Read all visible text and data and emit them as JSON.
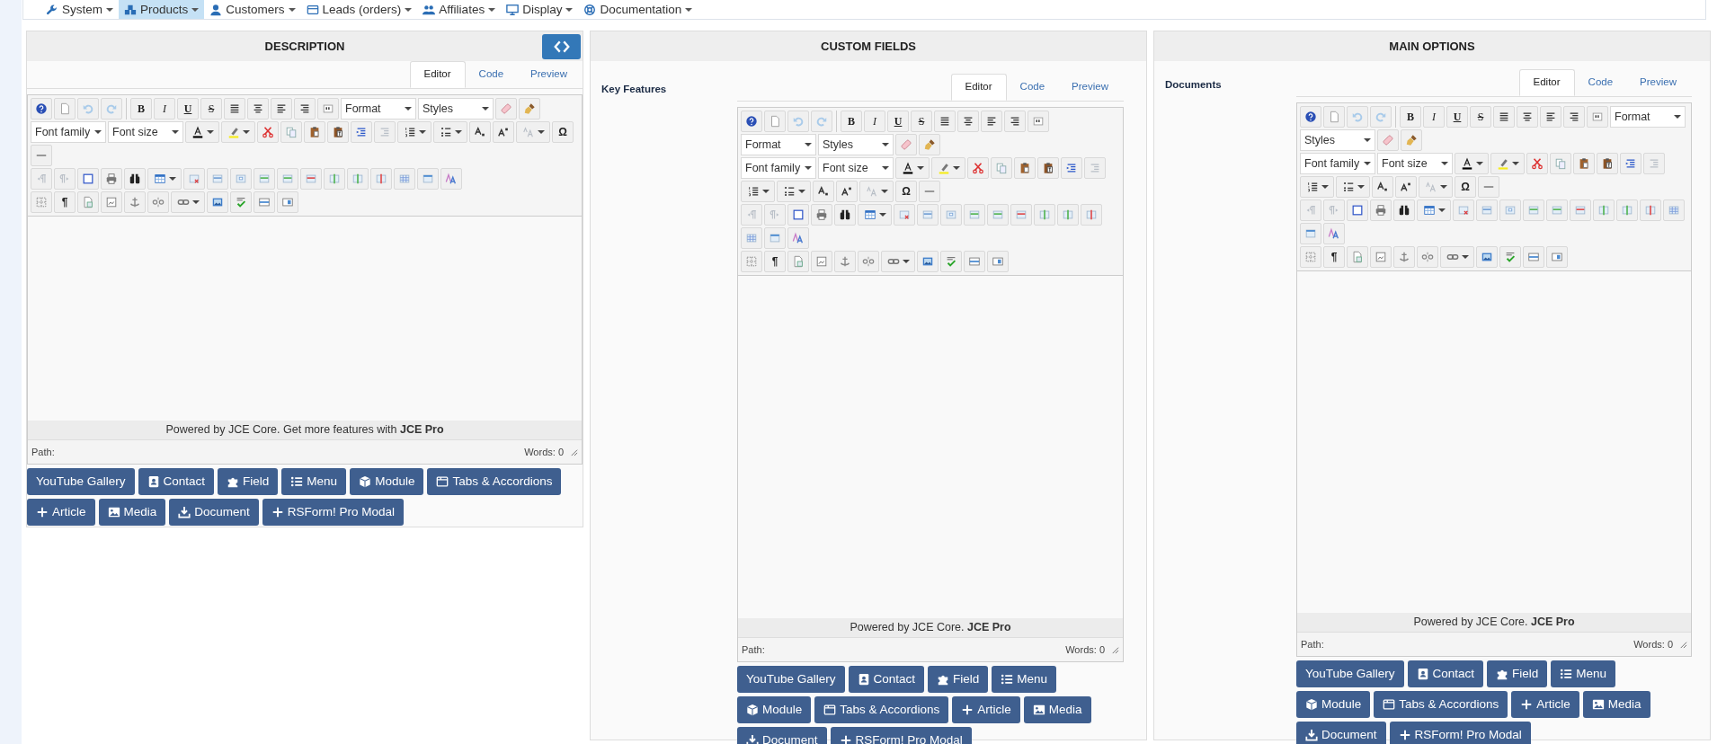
{
  "nav": {
    "items": [
      {
        "label": "System",
        "selected": false
      },
      {
        "label": "Products",
        "selected": true
      },
      {
        "label": "Customers",
        "selected": false
      },
      {
        "label": "Leads (orders)",
        "selected": false
      },
      {
        "label": "Affiliates",
        "selected": false
      },
      {
        "label": "Display",
        "selected": false
      },
      {
        "label": "Documentation",
        "selected": false
      }
    ]
  },
  "panels": [
    {
      "title": "DESCRIPTION",
      "code_button": true,
      "editor": {
        "tabs": [
          {
            "label": "Editor",
            "selected": true
          },
          {
            "label": "Code",
            "selected": false
          },
          {
            "label": "Preview",
            "selected": false
          }
        ],
        "toolbar": [
          [
            {
              "kind": "button"
            },
            {
              "kind": "button"
            },
            {
              "kind": "button"
            },
            {
              "kind": "button"
            },
            {
              "kind": "separator"
            },
            {
              "kind": "glyph",
              "text": "B"
            },
            {
              "kind": "glyph",
              "text": "I"
            },
            {
              "kind": "glyph",
              "text": "U"
            },
            {
              "kind": "glyph",
              "text": "S"
            },
            {
              "kind": "button"
            },
            {
              "kind": "button"
            },
            {
              "kind": "button"
            },
            {
              "kind": "button"
            },
            {
              "kind": "button"
            },
            {
              "kind": "select",
              "label": "Format"
            },
            {
              "kind": "select",
              "label": "Styles"
            },
            {
              "kind": "button"
            },
            {
              "kind": "button"
            }
          ],
          [
            {
              "kind": "select",
              "label": "Font family"
            },
            {
              "kind": "select",
              "label": "Font size"
            },
            {
              "kind": "split"
            },
            {
              "kind": "split"
            },
            {
              "kind": "button"
            },
            {
              "kind": "button"
            },
            {
              "kind": "button"
            },
            {
              "kind": "button"
            },
            {
              "kind": "button"
            },
            {
              "kind": "button"
            },
            {
              "kind": "split"
            },
            {
              "kind": "split"
            },
            {
              "kind": "button"
            },
            {
              "kind": "button"
            },
            {
              "kind": "split"
            },
            {
              "kind": "glyph",
              "text": "Ω"
            },
            {
              "kind": "button"
            }
          ],
          [
            {
              "kind": "button"
            },
            {
              "kind": "button"
            },
            {
              "kind": "button"
            },
            {
              "kind": "button"
            },
            {
              "kind": "button"
            },
            {
              "kind": "split"
            },
            {
              "kind": "button"
            },
            {
              "kind": "button"
            },
            {
              "kind": "button"
            },
            {
              "kind": "button"
            },
            {
              "kind": "button"
            },
            {
              "kind": "button"
            },
            {
              "kind": "button"
            },
            {
              "kind": "button"
            },
            {
              "kind": "button"
            },
            {
              "kind": "button"
            },
            {
              "kind": "button"
            },
            {
              "kind": "button"
            }
          ],
          [
            {
              "kind": "button"
            },
            {
              "kind": "glyph",
              "text": "¶"
            },
            {
              "kind": "button"
            },
            {
              "kind": "button"
            },
            {
              "kind": "button"
            },
            {
              "kind": "button"
            },
            {
              "kind": "split"
            },
            {
              "kind": "button"
            },
            {
              "kind": "button"
            },
            {
              "kind": "button"
            },
            {
              "kind": "button"
            }
          ]
        ],
        "notice": "Powered by JCE Core. Get more features with **JCE Pro**",
        "path_label": "Path:",
        "word_count": "Words: 0"
      },
      "buttons": [
        {
          "label": "YouTube Gallery"
        },
        {
          "label": "Contact"
        },
        {
          "label": "Field"
        },
        {
          "label": "Menu"
        },
        {
          "label": "Module"
        },
        {
          "label": "Tabs & Accordions"
        },
        {
          "label": "Article"
        },
        {
          "label": "Media"
        },
        {
          "label": "Document"
        },
        {
          "label": "RSForm! Pro Modal"
        }
      ]
    },
    {
      "title": "CUSTOM FIELDS",
      "field_label": "Key Features",
      "editor": {
        "tabs": [
          {
            "label": "Editor",
            "selected": true
          },
          {
            "label": "Code",
            "selected": false
          },
          {
            "label": "Preview",
            "selected": false
          }
        ],
        "toolbar": [
          [
            {
              "kind": "button"
            },
            {
              "kind": "button"
            },
            {
              "kind": "button"
            },
            {
              "kind": "button"
            },
            {
              "kind": "separator"
            },
            {
              "kind": "glyph",
              "text": "B"
            },
            {
              "kind": "glyph",
              "text": "I"
            },
            {
              "kind": "glyph",
              "text": "U"
            },
            {
              "kind": "glyph",
              "text": "S"
            },
            {
              "kind": "button"
            },
            {
              "kind": "button"
            },
            {
              "kind": "button"
            },
            {
              "kind": "button"
            },
            {
              "kind": "button"
            },
            {
              "kind": "select",
              "label": "Format"
            },
            {
              "kind": "select",
              "label": "Styles"
            },
            {
              "kind": "button"
            },
            {
              "kind": "button"
            }
          ],
          [
            {
              "kind": "select",
              "label": "Font family"
            },
            {
              "kind": "select",
              "label": "Font size"
            },
            {
              "kind": "split"
            },
            {
              "kind": "split"
            },
            {
              "kind": "button"
            },
            {
              "kind": "button"
            },
            {
              "kind": "button"
            },
            {
              "kind": "button"
            },
            {
              "kind": "button"
            },
            {
              "kind": "button"
            },
            {
              "kind": "split"
            },
            {
              "kind": "split"
            },
            {
              "kind": "button"
            },
            {
              "kind": "button"
            },
            {
              "kind": "split"
            },
            {
              "kind": "glyph",
              "text": "Ω"
            },
            {
              "kind": "button"
            }
          ],
          [
            {
              "kind": "button"
            },
            {
              "kind": "button"
            },
            {
              "kind": "button"
            },
            {
              "kind": "button"
            },
            {
              "kind": "button"
            },
            {
              "kind": "split"
            },
            {
              "kind": "button"
            },
            {
              "kind": "button"
            },
            {
              "kind": "button"
            },
            {
              "kind": "button"
            },
            {
              "kind": "button"
            },
            {
              "kind": "button"
            },
            {
              "kind": "button"
            },
            {
              "kind": "button"
            },
            {
              "kind": "button"
            },
            {
              "kind": "button"
            },
            {
              "kind": "button"
            },
            {
              "kind": "button"
            }
          ],
          [
            {
              "kind": "button"
            },
            {
              "kind": "glyph",
              "text": "¶"
            },
            {
              "kind": "button"
            },
            {
              "kind": "button"
            },
            {
              "kind": "button"
            },
            {
              "kind": "button"
            },
            {
              "kind": "split"
            },
            {
              "kind": "button"
            },
            {
              "kind": "button"
            },
            {
              "kind": "button"
            },
            {
              "kind": "button"
            }
          ]
        ],
        "notice": "Powered by JCE Core. **JCE Pro**",
        "path_label": "Path:",
        "word_count": "Words: 0"
      },
      "buttons": [
        {
          "label": "YouTube Gallery"
        },
        {
          "label": "Contact"
        },
        {
          "label": "Field"
        },
        {
          "label": "Menu"
        },
        {
          "label": "Module"
        },
        {
          "label": "Tabs & Accordions"
        },
        {
          "label": "Article"
        },
        {
          "label": "Media"
        },
        {
          "label": "Document"
        },
        {
          "label": "RSForm! Pro Modal"
        }
      ]
    },
    {
      "title": "MAIN OPTIONS",
      "field_label": "Documents",
      "editor": {
        "tabs": [
          {
            "label": "Editor",
            "selected": true
          },
          {
            "label": "Code",
            "selected": false
          },
          {
            "label": "Preview",
            "selected": false
          }
        ],
        "toolbar": [
          [
            {
              "kind": "button"
            },
            {
              "kind": "button"
            },
            {
              "kind": "button"
            },
            {
              "kind": "button"
            },
            {
              "kind": "separator"
            },
            {
              "kind": "glyph",
              "text": "B"
            },
            {
              "kind": "glyph",
              "text": "I"
            },
            {
              "kind": "glyph",
              "text": "U"
            },
            {
              "kind": "glyph",
              "text": "S"
            },
            {
              "kind": "button"
            },
            {
              "kind": "button"
            },
            {
              "kind": "button"
            },
            {
              "kind": "button"
            },
            {
              "kind": "button"
            },
            {
              "kind": "select",
              "label": "Format"
            },
            {
              "kind": "select",
              "label": "Styles"
            },
            {
              "kind": "button"
            },
            {
              "kind": "button"
            }
          ],
          [
            {
              "kind": "select",
              "label": "Font family"
            },
            {
              "kind": "select",
              "label": "Font size"
            },
            {
              "kind": "split"
            },
            {
              "kind": "split"
            },
            {
              "kind": "button"
            },
            {
              "kind": "button"
            },
            {
              "kind": "button"
            },
            {
              "kind": "button"
            },
            {
              "kind": "button"
            },
            {
              "kind": "button"
            },
            {
              "kind": "split"
            },
            {
              "kind": "split"
            },
            {
              "kind": "button"
            },
            {
              "kind": "button"
            },
            {
              "kind": "split"
            },
            {
              "kind": "glyph",
              "text": "Ω"
            },
            {
              "kind": "button"
            }
          ],
          [
            {
              "kind": "button"
            },
            {
              "kind": "button"
            },
            {
              "kind": "button"
            },
            {
              "kind": "button"
            },
            {
              "kind": "button"
            },
            {
              "kind": "split"
            },
            {
              "kind": "button"
            },
            {
              "kind": "button"
            },
            {
              "kind": "button"
            },
            {
              "kind": "button"
            },
            {
              "kind": "button"
            },
            {
              "kind": "button"
            },
            {
              "kind": "button"
            },
            {
              "kind": "button"
            },
            {
              "kind": "button"
            },
            {
              "kind": "button"
            },
            {
              "kind": "button"
            },
            {
              "kind": "button"
            }
          ],
          [
            {
              "kind": "button"
            },
            {
              "kind": "glyph",
              "text": "¶"
            },
            {
              "kind": "button"
            },
            {
              "kind": "button"
            },
            {
              "kind": "button"
            },
            {
              "kind": "button"
            },
            {
              "kind": "split"
            },
            {
              "kind": "button"
            },
            {
              "kind": "button"
            },
            {
              "kind": "button"
            },
            {
              "kind": "button"
            }
          ]
        ],
        "notice": "Powered by JCE Core. **JCE Pro**",
        "path_label": "Path:",
        "word_count": "Words: 0"
      },
      "buttons": [
        {
          "label": "YouTube Gallery"
        },
        {
          "label": "Contact"
        },
        {
          "label": "Field"
        },
        {
          "label": "Menu"
        },
        {
          "label": "Module"
        },
        {
          "label": "Tabs & Accordions"
        },
        {
          "label": "Article"
        },
        {
          "label": "Media"
        },
        {
          "label": "Document"
        },
        {
          "label": "RSForm! Pro Modal"
        }
      ]
    }
  ]
}
